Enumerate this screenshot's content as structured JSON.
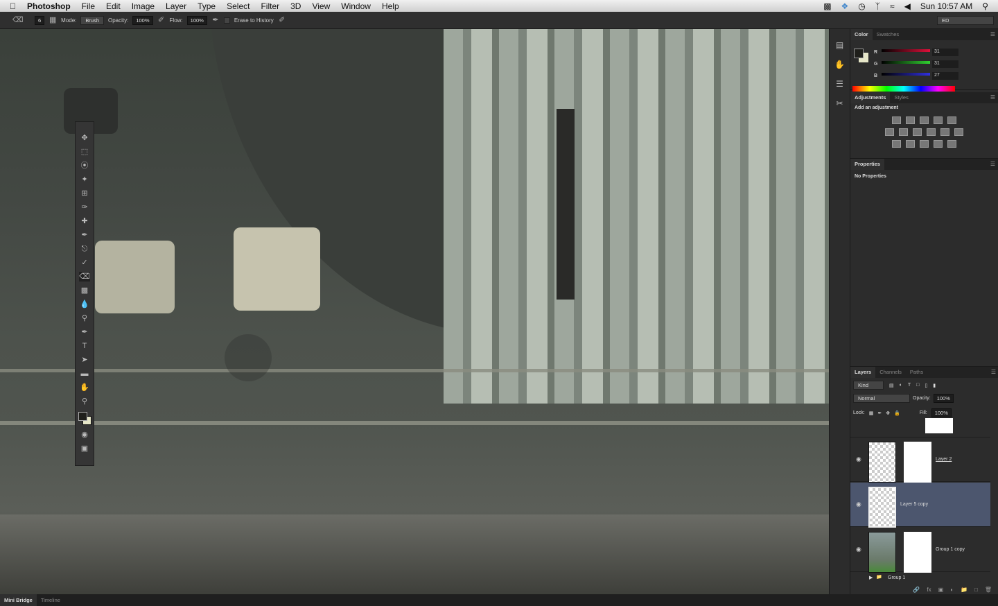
{
  "menubar": {
    "app": "Photoshop",
    "items": [
      "File",
      "Edit",
      "Image",
      "Layer",
      "Type",
      "Select",
      "Filter",
      "3D",
      "View",
      "Window",
      "Help"
    ],
    "clock": "Sun 10:57 AM"
  },
  "options": {
    "brush_size": "6",
    "mode_label": "Mode:",
    "mode": "Brush",
    "opacity_label": "Opacity:",
    "opacity": "100%",
    "flow_label": "Flow:",
    "flow": "100%",
    "erase_history": "Erase to History",
    "workspace": "ED"
  },
  "color": {
    "tabs": [
      "Color",
      "Swatches"
    ],
    "r": "31",
    "g": "31",
    "b": "27",
    "r_label": "R",
    "g_label": "G",
    "b_label": "B",
    "fg": "#1f1f1b",
    "bg": "#e6e6c8"
  },
  "adjustments": {
    "tabs": [
      "Adjustments",
      "Styles"
    ],
    "heading": "Add an adjustment"
  },
  "properties": {
    "tab": "Properties",
    "text": "No Properties"
  },
  "layers": {
    "tabs": [
      "Layers",
      "Channels",
      "Paths"
    ],
    "kind": "Kind",
    "blend": "Normal",
    "opacity_label": "Opacity:",
    "opacity": "100%",
    "lock_label": "Lock:",
    "fill_label": "Fill:",
    "fill": "100%",
    "items": [
      {
        "name": "Layer 2"
      },
      {
        "name": "Layer 5 copy",
        "selected": true
      },
      {
        "name": "Group 1 copy"
      },
      {
        "name": "Group 1"
      }
    ]
  },
  "bottom": {
    "tabs": [
      "Mini Bridge",
      "Timeline"
    ]
  }
}
